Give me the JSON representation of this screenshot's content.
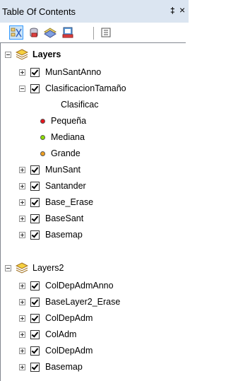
{
  "window": {
    "title": "Table Of Contents",
    "pin_glyph": "‡",
    "close_glyph": "×"
  },
  "toolbar": {
    "buttons": [
      {
        "icon": "list-by-drawing-order-icon",
        "active": true
      },
      {
        "icon": "list-by-source-icon"
      },
      {
        "icon": "list-by-visibility-icon"
      },
      {
        "icon": "list-by-selection-icon"
      },
      {
        "icon": "options-icon"
      }
    ]
  },
  "tree": {
    "group1": {
      "label": "Layers",
      "layers": [
        {
          "label": "MunSantAnno",
          "expanded": false,
          "checked": true
        },
        {
          "label": "ClasificacionTamaño",
          "expanded": true,
          "checked": true,
          "legend_field": "Clasificac",
          "legend": [
            {
              "label": "Pequeña",
              "color": "#e8141c"
            },
            {
              "label": "Mediana",
              "color": "#8ee000"
            },
            {
              "label": "Grande",
              "color": "#f0a020"
            }
          ]
        },
        {
          "label": "MunSant",
          "expanded": false,
          "checked": true
        },
        {
          "label": "Santander",
          "expanded": false,
          "checked": true
        },
        {
          "label": "Base_Erase",
          "expanded": false,
          "checked": true
        },
        {
          "label": "BaseSant",
          "expanded": false,
          "checked": true
        },
        {
          "label": "Basemap",
          "expanded": false,
          "checked": true
        }
      ]
    },
    "group2": {
      "label": "Layers2",
      "layers": [
        {
          "label": "ColDepAdmAnno",
          "checked": true
        },
        {
          "label": "BaseLayer2_Erase",
          "checked": true
        },
        {
          "label": "ColDepAdm",
          "checked": true
        },
        {
          "label": "ColAdm",
          "checked": true
        },
        {
          "label": "ColDepAdm",
          "checked": true
        },
        {
          "label": "Basemap",
          "checked": true
        }
      ]
    }
  }
}
